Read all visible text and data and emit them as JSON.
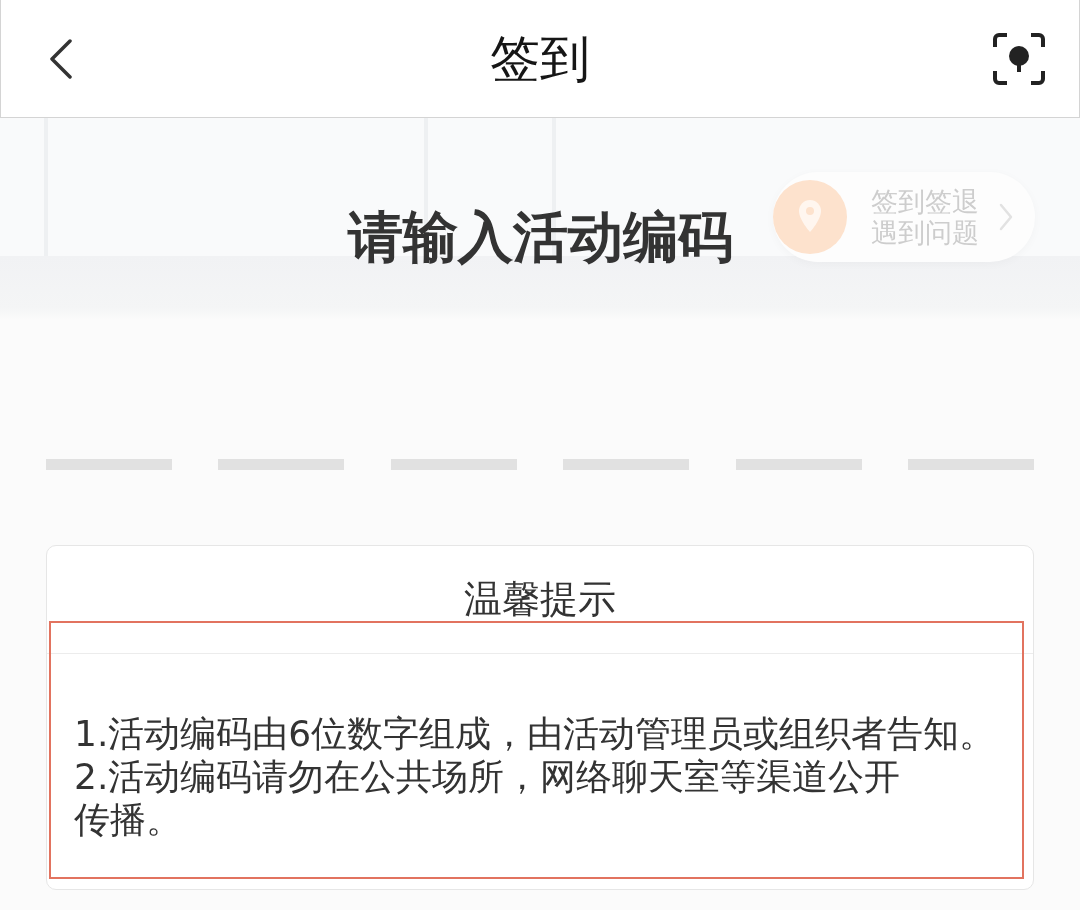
{
  "nav_bar": {
    "title": "签到"
  },
  "map_panel": {
    "heading": "请输入活动编码",
    "help_button": {
      "lines": [
        "签到签退",
        "遇到问题"
      ]
    }
  },
  "code_slots": [
    {
      "kind": "empty"
    },
    {
      "kind": "empty"
    },
    {
      "kind": "empty"
    },
    {
      "kind": "empty"
    },
    {
      "kind": "empty"
    },
    {
      "kind": "empty"
    }
  ],
  "tips_card": {
    "title": "温馨提示",
    "items": [
      "1.活动编码由6位数字组成，由活动管理员或组织者告知。",
      "2.活动编码请勿在公共场所，网络聊天室等渠道公开传播。"
    ]
  }
}
